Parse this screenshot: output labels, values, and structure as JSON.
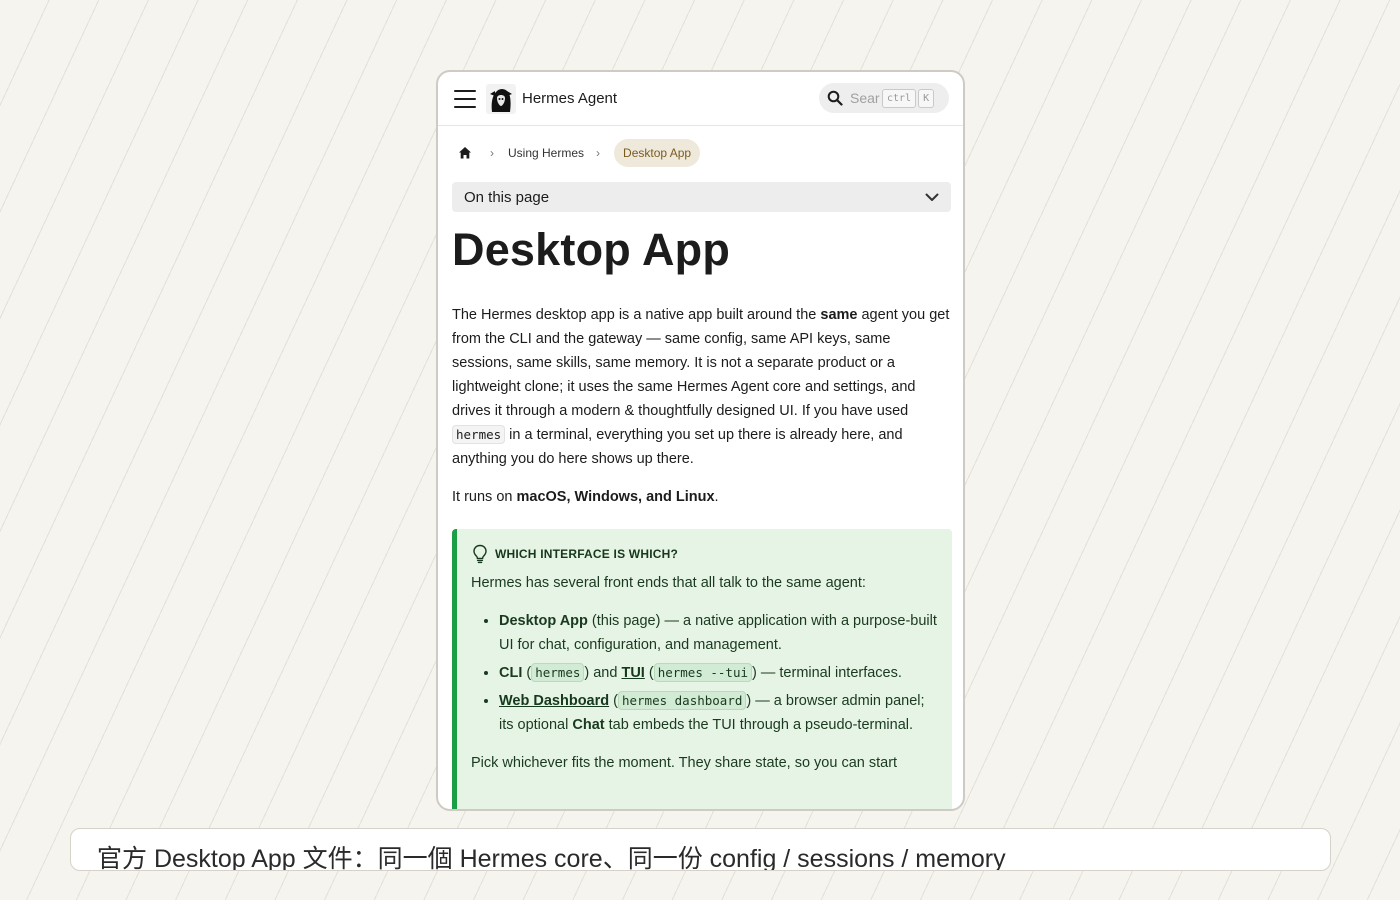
{
  "navbar": {
    "brand": "Hermes Agent",
    "search_placeholder": "Search",
    "kbd_ctrl": "ctrl",
    "kbd_k": "K"
  },
  "breadcrumb": {
    "items": [
      "Using Hermes",
      "Desktop App"
    ]
  },
  "toc_label": "On this page",
  "page_title": "Desktop App",
  "intro": {
    "part1": "The Hermes desktop app is a native app built around the ",
    "bold": "same",
    "part2": " agent you get from the CLI and the gateway — same config, same API keys, same sessions, same skills, same memory. It is not a separate product or a lightweight clone; it uses the same Hermes Agent core and settings, and drives it through a modern & thoughtfully designed UI. If you have used ",
    "code": "hermes",
    "part3": " in a terminal, everything you set up there is already here, and anything you do here shows up there."
  },
  "runs_on": {
    "prefix": "It runs on ",
    "bold": "macOS, Windows, and Linux",
    "suffix": "."
  },
  "admonition": {
    "heading": "WHICH INTERFACE IS WHICH?",
    "lead": "Hermes has several front ends that all talk to the same agent:",
    "items": [
      {
        "title": "Desktop App",
        "note": " (this page) — a native application with a purpose-built UI for chat, configuration, and management."
      },
      {
        "cli": "CLI",
        "cli_code": "hermes",
        "and": " and ",
        "tui": "TUI",
        "tui_code": "hermes --tui",
        "tail": " — terminal interfaces."
      },
      {
        "title": "Web Dashboard",
        "code": "hermes dashboard",
        "tail1": " — a browser admin panel; its optional ",
        "chat": "Chat",
        "tail2": " tab embeds the TUI through a pseudo-terminal."
      }
    ],
    "closing": "Pick whichever fits the moment. They share state, so you can start"
  },
  "caption": "官方 Desktop App 文件：同一個 Hermes core、同一份 config / sessions / memory",
  "colors": {
    "accent_green": "#1c9e45",
    "admonition_bg": "#e6f4e6",
    "crumb_active_bg": "#efe9dc"
  }
}
